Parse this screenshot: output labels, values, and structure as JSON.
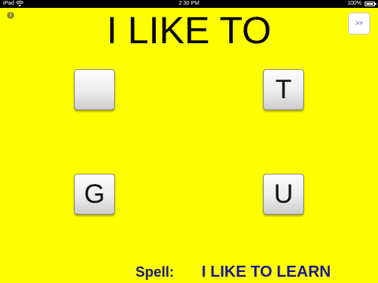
{
  "status_bar": {
    "carrier": "iPad",
    "time": "2:30 PM",
    "battery": "100%"
  },
  "header": {
    "info_icon": "info-icon",
    "info_glyph": "i",
    "headline": "I LIKE TO",
    "next_label": ">>"
  },
  "tiles": [
    {
      "letter": ""
    },
    {
      "letter": "T"
    },
    {
      "letter": "G"
    },
    {
      "letter": "U"
    }
  ],
  "footer": {
    "spell_label": "Spell:",
    "spell_target": "I LIKE TO LEARN"
  },
  "colors": {
    "background": "#ffff00",
    "spell_text": "#1a1a90"
  }
}
